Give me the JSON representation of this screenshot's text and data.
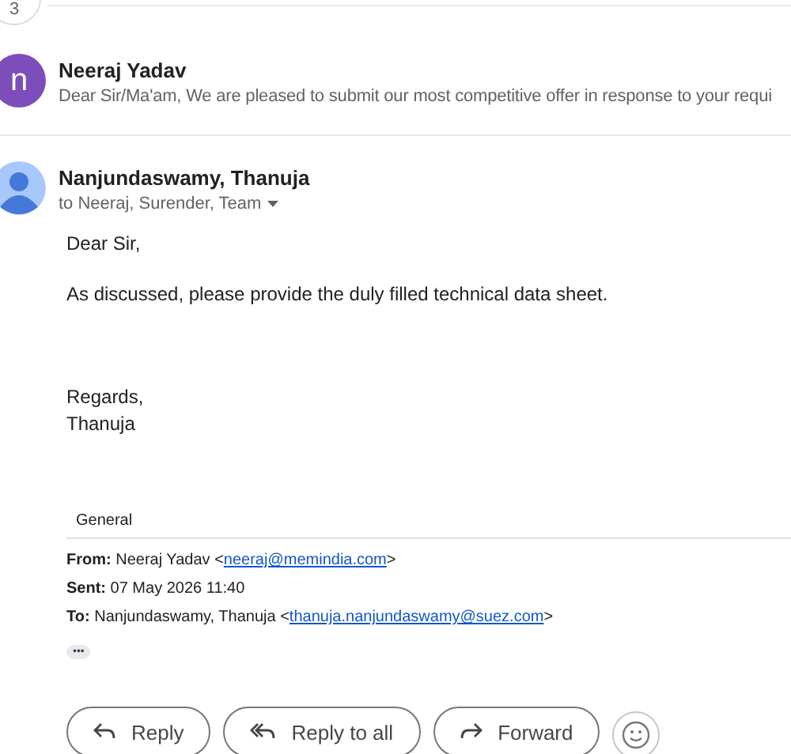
{
  "thread_count": "3",
  "collapsed_message": {
    "avatar_letter": "n",
    "sender": "Neeraj Yadav",
    "snippet": "Dear Sir/Ma'am, We are pleased to submit our most competitive offer in response to your requi"
  },
  "message": {
    "sender": "Nanjundaswamy, Thanuja",
    "recipients": "to Neeraj, Surender, Team",
    "body": [
      "Dear Sir,",
      "As discussed, please provide the duly filled technical data sheet.",
      "Regards,",
      "Thanuja"
    ],
    "label": "General",
    "quoted_header": [
      {
        "label": "From:",
        "text": "Neeraj Yadav <",
        "link": "neeraj@memindia.com",
        "after": ">"
      },
      {
        "label": "Sent:",
        "text": "07 May 2026 11:40"
      },
      {
        "label": "To:",
        "text": "Nanjundaswamy, Thanuja <",
        "link": "thanuja.nanjundaswamy@suez.com",
        "after": ">"
      }
    ],
    "show_trimmed": "•••"
  },
  "actions": [
    {
      "kind": "reply",
      "label": "Reply"
    },
    {
      "kind": "reply_all",
      "label": "Reply to all"
    },
    {
      "kind": "forward",
      "label": "Forward"
    }
  ]
}
